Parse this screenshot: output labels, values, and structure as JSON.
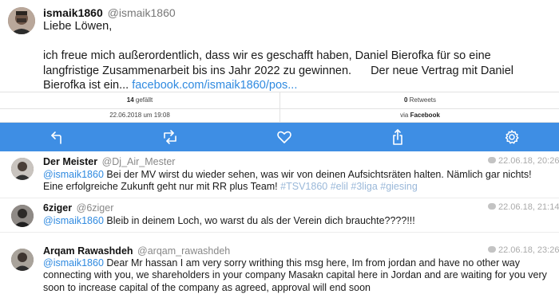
{
  "tweet": {
    "name": "ismaik1860",
    "handle": "@ismaik1860",
    "greeting": "Liebe Löwen,",
    "body_part1": "ich freue mich außerordentlich, dass wir es geschafft haben, Daniel Bierofka für so eine langfristige Zusammenarbeit bis ins Jahr 2022 zu gewinnen.",
    "body_part2": "Der neue Vertrag mit Daniel Bierofka ist ein...",
    "link": "facebook.com/ismaik1860/pos..."
  },
  "stats": {
    "likes_count": "14",
    "likes_label": "gefällt",
    "retweets_count": "0",
    "retweets_label": "Retweets"
  },
  "meta": {
    "datetime": "22.06.2018 um 19:08",
    "via_label": "via",
    "source": "Facebook"
  },
  "toolbar": {
    "color": "#3e8ee4",
    "icons": [
      "reply-icon",
      "retweet-icon",
      "like-icon",
      "share-icon",
      "settings-icon"
    ]
  },
  "replies": [
    {
      "name": "Der Meister",
      "handle": "@Dj_Air_Mester",
      "time": "22.06.18, 20:26",
      "mention": "@ismaik1860",
      "text": "Bei der MV wirst du wieder sehen, was wir von deinen Aufsichtsräten halten. Nämlich gar nichts! Eine erfolgreiche Zukunft geht nur mit RR plus Team!",
      "hashtags": "#TSV1860 #elil #3liga #giesing"
    },
    {
      "name": "6ziger",
      "handle": "@6ziger",
      "time": "22.06.18, 21:14",
      "mention": "@ismaik1860",
      "text": "Bleib in deinem Loch, wo warst du als der Verein dich brauchte????!!!"
    },
    {
      "name": "Arqam Rawashdeh",
      "handle": "@arqam_rawashdeh",
      "time": "22.06.18, 23:26",
      "mention": "@ismaik1860",
      "text": "Dear Mr hassan I am very sorry writhing this msg here, Im from jordan and have no other way connecting with you, we shareholders in your company Masakn capital here in Jordan and are waiting for you very soon to increase capital of the company as agreed, approval will end soon"
    }
  ]
}
